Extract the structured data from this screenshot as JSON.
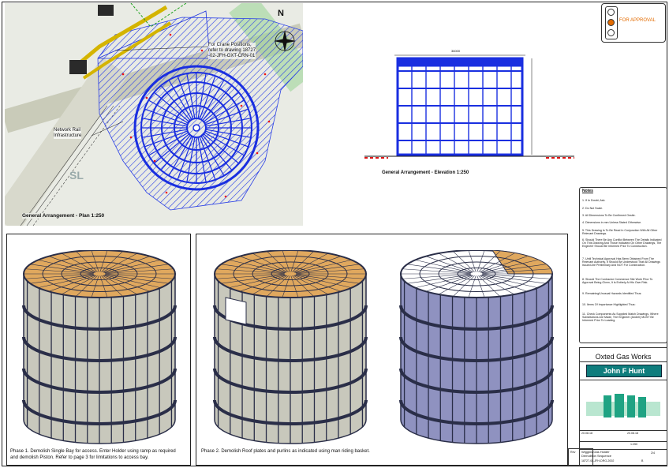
{
  "plan": {
    "caption": "General Arrangement - Plan 1:250",
    "crane_note": "For Crane Positions,\nrefer to drawing 18727\n-02-JFH-OXT-CRN-01",
    "rail_note": "Network Rail\nInfrastructure",
    "ground_label": "SL",
    "north_label": "N"
  },
  "elevation": {
    "caption": "General Arrangement - Elevation 1:250",
    "dim_top": "36000"
  },
  "approval": {
    "status": "FOR APPROVAL",
    "active_lamp": "amber"
  },
  "notes": {
    "title": "Notes",
    "items": [
      {
        "num": "1.",
        "text": "If In Doubt, Ask."
      },
      {
        "num": "2.",
        "text": "Do Not Scale."
      },
      {
        "num": "3.",
        "text": "All Dimensions To Be Confirmed Onsite."
      },
      {
        "num": "4.",
        "text": "Dimensions in mm Unless Stated Otherwise."
      },
      {
        "num": "5.",
        "text": "This Drawing Is To Be Read In Conjunction With All Other Relevant Drawings."
      },
      {
        "num": "6.",
        "text": "Should There Be Any Conflict Between The Details Indicated On This Drawing And Those Indicated On Other Drawings, The Engineer Should Be Informed Prior To Construction."
      },
      {
        "num": "7.",
        "text": "Until Technical Approval Has Been Obtained From The Relevant Authority, It Should Be Understood That All Drawings Issued Are Preliminary And NOT For Construction."
      },
      {
        "num": "8.",
        "text": "Should The Contractor Commence Site Work Prior To Approval Being Given, It Is Entirely At His Own Risk."
      },
      {
        "num": "9.",
        "text": "Remaining/Unusual Hazards Identified Thus:"
      },
      {
        "num": "10.",
        "text": "Items Of Importance Highlighted Thus:"
      },
      {
        "num": "11.",
        "text": "Check Components As Supplied Match Drawings. Where Substitutions Are Made, The Engineer (Andrei) MUST Be Informed Prior To Loading."
      }
    ]
  },
  "title_block": {
    "site": "Oxted Gas Works",
    "client": "John F Hunt",
    "drawing_title": "Wiggins Gas Holder\nDemolition Sequence",
    "drawing_number": "18727-08-JFH-DRG-2002",
    "rev": "B",
    "rev_label": "Rev",
    "date1": "20.08.18",
    "date2": "20.08.18",
    "scale": "1:250",
    "sheet": "2/4"
  },
  "phases": [
    {
      "caption": "Phase 1. Demolish Single Bay for access. Enter Holder using ramp as required\nand demolish Piston. Refer to page 3 for limitations to access bay."
    },
    {
      "caption": "Phase 2. Demolish Roof plates and purlins as indicated using man riding basket."
    }
  ],
  "colors": {
    "holder_blue": "#1a2fe0",
    "roof_orange": "#e0a85e",
    "wall_grey": "#c8c8bc",
    "frame_dark": "#2a2e48",
    "crane_yellow": "#d4b400",
    "approval_orange": "#e36b00",
    "client_teal": "#0f7d7d"
  }
}
